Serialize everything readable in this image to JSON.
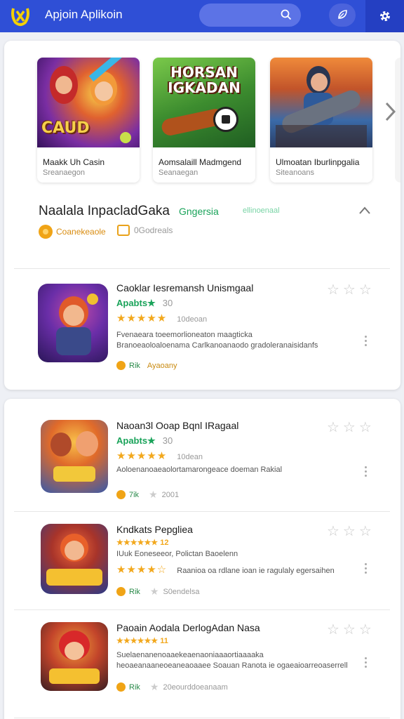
{
  "header": {
    "title": "Apjoin Aplikoin",
    "logo_icon": "app-logo-icon",
    "search_icon": "search-icon",
    "action_icon": "leaf-icon",
    "settings_icon": "gear-icon",
    "accent": "#2f4fd6"
  },
  "featured": [
    {
      "title": "Maakk Uh Casin",
      "subtitle": "Sreanaegon",
      "art_text": "CAUD"
    },
    {
      "title": "Aomsalaill Madmgend",
      "subtitle": "Seanaegan",
      "art_text": "HORSAN IGKADAN"
    },
    {
      "title": "Ulmoatan Iburlinpgalia",
      "subtitle": "Siteanoans",
      "art_text": ""
    }
  ],
  "section": {
    "title": "Naalala InpacladGaka",
    "tag": "Gngersia",
    "faint_tag": "ellinoenaal",
    "meta": [
      {
        "label": "Coanekeaole",
        "icon": "coin-icon"
      },
      {
        "label": "0Godreals",
        "icon": "box-icon"
      }
    ]
  },
  "apps": [
    {
      "title": "Caoklar Iesremansh Unismgaal",
      "category": "Apabts★",
      "category_extra": "30",
      "stars": "★★★★★",
      "rating_text": "10deoan",
      "desc1": "Fvenaeara toeemorlioneaton maagticka",
      "desc2": "Branoeaoloaloenama Carlkanoanaodo gradoleranaisidanfs",
      "foot_a": "Rik",
      "foot_b": "Ayaoany",
      "foot_c": ""
    },
    {
      "title": "Naoan3l Ooap Bqnl IRagaal",
      "category": "Apabts★",
      "category_extra": "30",
      "stars": "★★★★★",
      "rating_text": "10dean",
      "desc1": "Aoloenanoaeaolortamarongeace doeman Rakial",
      "desc2": "",
      "foot_a": "7ik",
      "foot_b": "",
      "foot_c": "2001"
    },
    {
      "title": "Kndkats Pepgliea",
      "category": "★★★★★★ 12",
      "category_extra": "",
      "stars": "★★★★☆",
      "rating_text": "Raanioa oa rdlane ioan ie ragulaly egersaihen",
      "desc1": "IUuk Eoneseeor,   Polictan Baoelenn",
      "desc2": "",
      "foot_a": "Rik",
      "foot_b": "",
      "foot_c": "S0endelsa"
    },
    {
      "title": "Paoain Aodala DerlogAdan Nasa",
      "category": "★★★★★★ 11",
      "category_extra": "",
      "stars": "",
      "rating_text": "",
      "desc1": "Suelaenanenoaaekeaenaoniaaaortiaaaaka",
      "desc2": "heoaeanaaneoeaneaoaaee Soauan Ranota ie ogaeaioarreoaserrell",
      "foot_a": "Rik",
      "foot_b": "",
      "foot_c": "20eourddoeanaam"
    }
  ]
}
